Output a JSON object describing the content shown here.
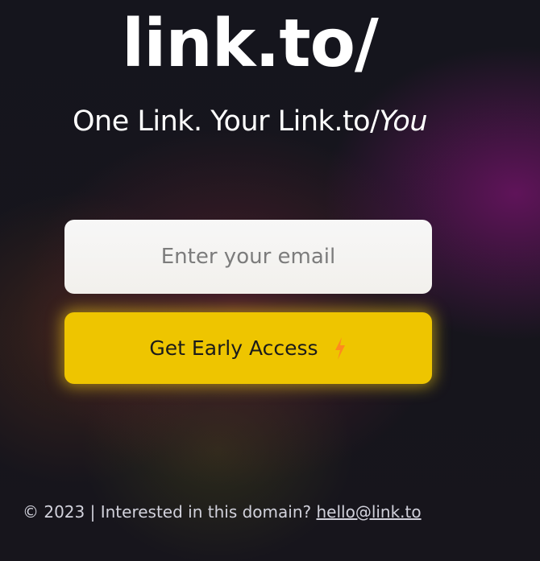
{
  "brand": {
    "logo_text": "link.to/"
  },
  "hero": {
    "tagline_main": "One Link. Your Link.to/",
    "tagline_emphasis": "You"
  },
  "signup": {
    "email_placeholder": "Enter your email",
    "email_value": "",
    "button_label": "Get Early Access",
    "button_icon": "lightning-bolt-icon"
  },
  "footer": {
    "copyright": "© 2023",
    "separator": "|",
    "prompt": "Interested in this domain?",
    "contact_email": "hello@link.to"
  },
  "colors": {
    "background": "#14141c",
    "button_bg": "#eec500",
    "bolt": "#ff8a1e",
    "input_bg": "#f7f7f7",
    "text": "#ffffff"
  }
}
